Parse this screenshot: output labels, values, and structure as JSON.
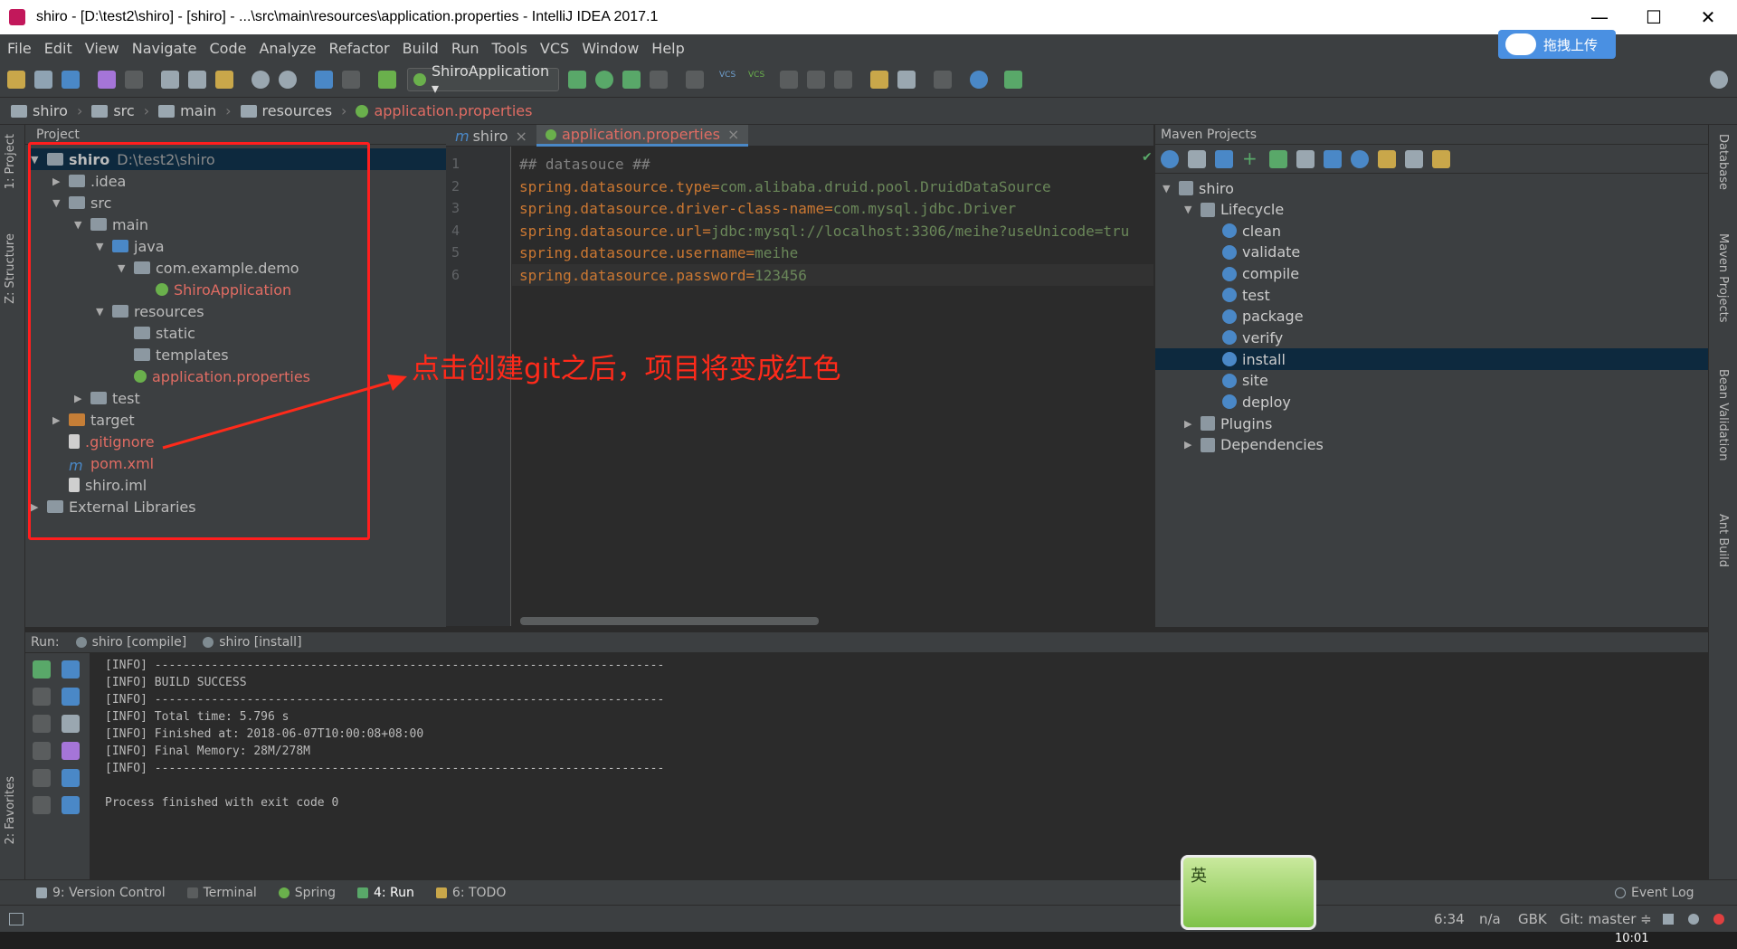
{
  "window": {
    "title": "shiro - [D:\\test2\\shiro] - [shiro] - ...\\src\\main\\resources\\application.properties - IntelliJ IDEA 2017.1",
    "minimize": "—",
    "maximize": "☐",
    "close": "✕"
  },
  "menu": [
    "File",
    "Edit",
    "View",
    "Navigate",
    "Code",
    "Analyze",
    "Refactor",
    "Build",
    "Run",
    "Tools",
    "VCS",
    "Window",
    "Help"
  ],
  "cloud_button": "拖拽上传",
  "toolbar": {
    "run_config": "ShiroApplication ▾",
    "vcs1": "VCS",
    "vcs2": "VCS"
  },
  "breadcrumb": [
    "shiro",
    "src",
    "main",
    "resources",
    "application.properties"
  ],
  "side_tabs": {
    "project": "1: Project",
    "structure": "Z: Structure",
    "favorites": "2: Favorites",
    "database": "Database",
    "maven": "Maven Projects",
    "bean": "Bean Validation",
    "ant": "Ant Build"
  },
  "project_panel": {
    "header": "Project",
    "tree": [
      {
        "label": "shiro",
        "extra": "D:\\test2\\shiro",
        "depth": 0,
        "arrow": "▼",
        "icon": "folder-grey",
        "bold": true
      },
      {
        "label": ".idea",
        "depth": 1,
        "arrow": "▶",
        "icon": "folder-grey"
      },
      {
        "label": "src",
        "depth": 1,
        "arrow": "▼",
        "icon": "folder-grey"
      },
      {
        "label": "main",
        "depth": 2,
        "arrow": "▼",
        "icon": "folder-grey"
      },
      {
        "label": "java",
        "depth": 3,
        "arrow": "▼",
        "icon": "folder-blue"
      },
      {
        "label": "com.example.demo",
        "depth": 4,
        "arrow": "▼",
        "icon": "folder-grey"
      },
      {
        "label": "ShiroApplication",
        "depth": 5,
        "arrow": "",
        "icon": "spring-class",
        "red": true
      },
      {
        "label": "resources",
        "depth": 3,
        "arrow": "▼",
        "icon": "folder-grey"
      },
      {
        "label": "static",
        "depth": 4,
        "arrow": "",
        "icon": "folder-grey"
      },
      {
        "label": "templates",
        "depth": 4,
        "arrow": "",
        "icon": "folder-grey"
      },
      {
        "label": "application.properties",
        "depth": 4,
        "arrow": "",
        "icon": "spring-properties",
        "red": true
      },
      {
        "label": "test",
        "depth": 2,
        "arrow": "▶",
        "icon": "folder-grey"
      },
      {
        "label": "target",
        "depth": 1,
        "arrow": "▶",
        "icon": "folder-orange"
      },
      {
        "label": ".gitignore",
        "depth": 1,
        "arrow": "",
        "icon": "file",
        "red": true
      },
      {
        "label": "pom.xml",
        "depth": 1,
        "arrow": "",
        "icon": "maven-file",
        "red": true
      },
      {
        "label": "shiro.iml",
        "depth": 1,
        "arrow": "",
        "icon": "file"
      },
      {
        "label": "External Libraries",
        "depth": 0,
        "arrow": "▶",
        "icon": "libraries"
      }
    ]
  },
  "editor": {
    "tabs": [
      {
        "label": "shiro",
        "active": false
      },
      {
        "label": "application.properties",
        "active": true
      }
    ],
    "line_numbers": [
      "1",
      "2",
      "3",
      "4",
      "5",
      "6"
    ],
    "lines": [
      {
        "k": "## datasouce ##",
        "v": "",
        "comment": true
      },
      {
        "k": "spring.datasource.type",
        "v": "com.alibaba.druid.pool.DruidDataSource"
      },
      {
        "k": "spring.datasource.driver-class-name",
        "v": "com.mysql.jdbc.Driver"
      },
      {
        "k": "spring.datasource.url",
        "v": "jdbc:mysql://localhost:3306/meihe?useUnicode=tru"
      },
      {
        "k": "spring.datasource.username",
        "v": "meihe"
      },
      {
        "k": "spring.datasource.password",
        "v": "123456"
      }
    ],
    "annotation": "点击创建git之后，项目将变成红色"
  },
  "maven_panel": {
    "header": "Maven Projects",
    "root": "shiro",
    "lifecycle": "Lifecycle",
    "goals": [
      "clean",
      "validate",
      "compile",
      "test",
      "package",
      "verify",
      "install",
      "site",
      "deploy"
    ],
    "selected_goal": "install",
    "plugins": "Plugins",
    "dependencies": "Dependencies"
  },
  "run_panel": {
    "label": "Run:",
    "tabs": [
      "shiro [compile]",
      "shiro [install]"
    ],
    "console": [
      "[INFO] ------------------------------------------------------------------------",
      "[INFO] BUILD SUCCESS",
      "[INFO] ------------------------------------------------------------------------",
      "[INFO] Total time: 5.796 s",
      "[INFO] Finished at: 2018-06-07T10:00:08+08:00",
      "[INFO] Final Memory: 28M/278M",
      "[INFO] ------------------------------------------------------------------------",
      "",
      "Process finished with exit code 0"
    ]
  },
  "bottom_tabs": [
    "9: Version Control",
    "Terminal",
    "Spring",
    "4: Run",
    "6: TODO"
  ],
  "event_log": "Event Log",
  "status": {
    "position": "6:34",
    "na": "n/a",
    "encoding": "GBK",
    "git": "Git: master ≑"
  },
  "ime": "英",
  "clock": "10:01",
  "colors": {
    "accent": "#4a88c7",
    "annotation": "#ff2a1a",
    "modified": "#e06c63",
    "bg": "#2b2b2b",
    "panel": "#3c3f41"
  }
}
